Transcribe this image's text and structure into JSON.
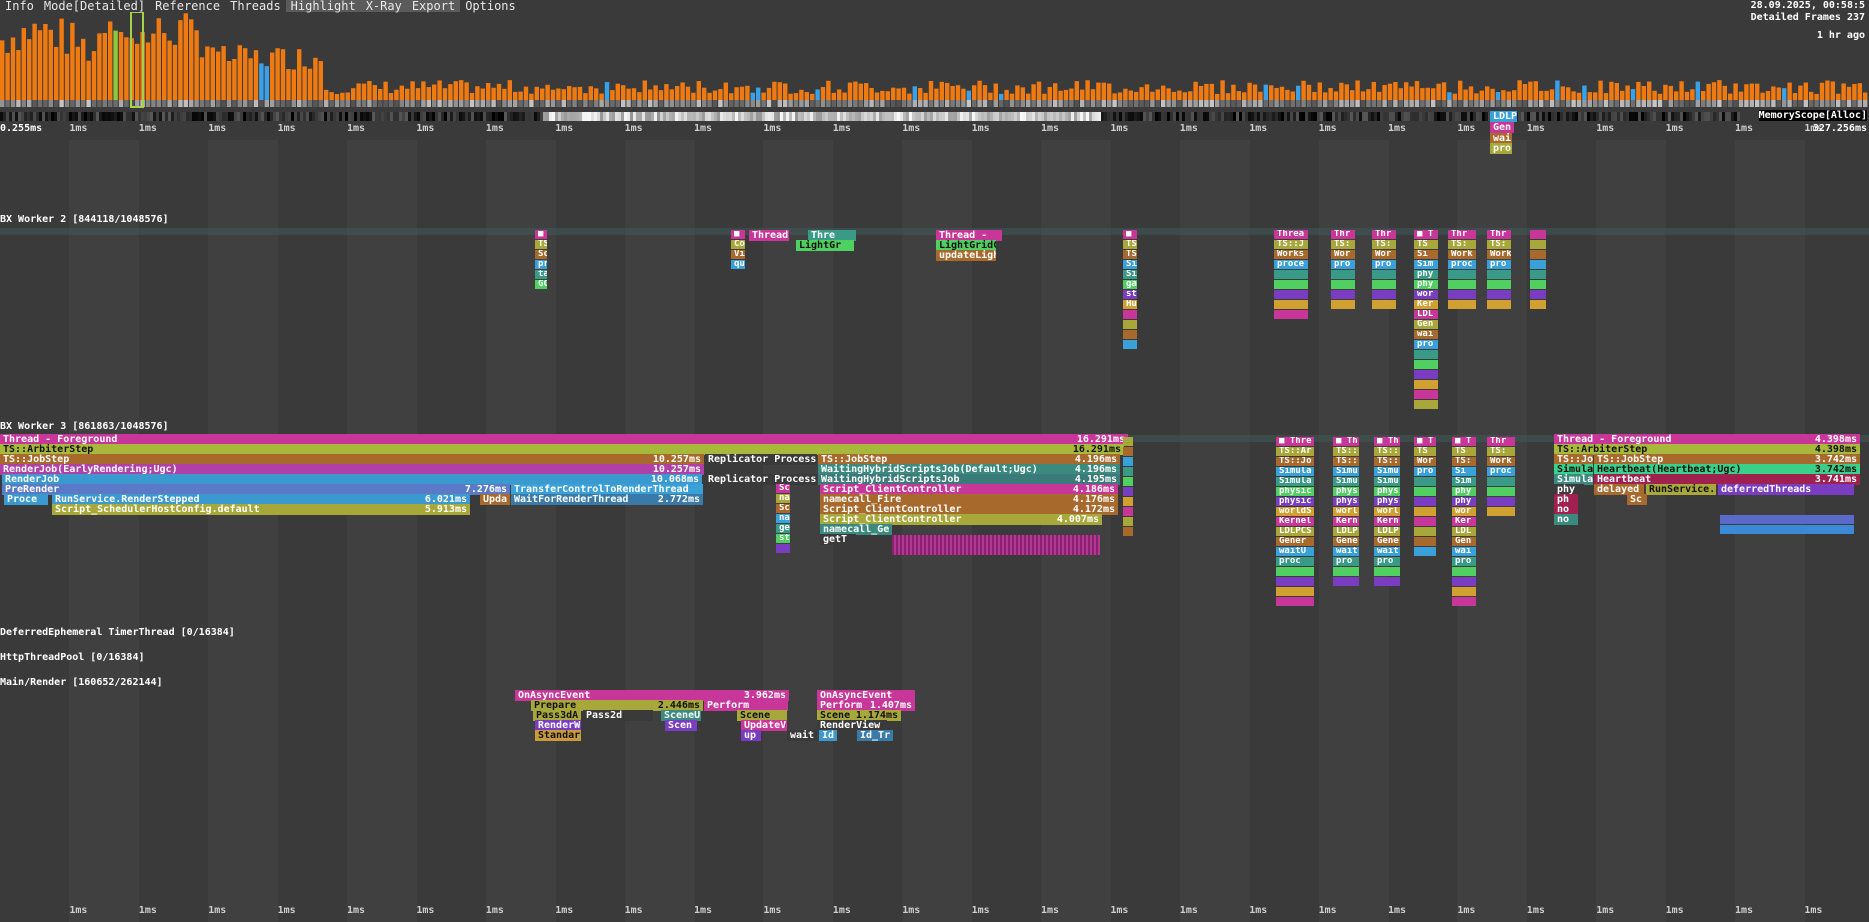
{
  "menu": [
    "Info",
    "Mode[Detailed]",
    "Reference",
    "Threads",
    "Highlight",
    "X-Ray",
    "Export",
    "Options"
  ],
  "status": {
    "date_line": "28.09.2025, 00:58:5",
    "frames_line": "Detailed Frames 237",
    "ago": "1 hr ago"
  },
  "timeline": {
    "start_label": "0.255ms",
    "end_label": "327.256ms",
    "tick_label": "1ms",
    "memory_scope": "MemoryScope[Alloc]",
    "memory_marker": "LDLP",
    "threads": [
      "BX Worker 2 [844118/1048576]",
      "BX Worker 3 [861863/1048576]",
      "DeferredEphemeral TimerThread [0/16384]",
      "HttpThreadPool [0/16384]",
      "Main/Render [160652/262144]"
    ]
  },
  "colors": {
    "bar": "#f07a12",
    "selected_bar": "#8cc83c",
    "highlight_bar": "#3aa0e8",
    "magenta": "#c8369a",
    "olive": "#a8a83a",
    "blue": "#3aa0d8",
    "teal": "#3a9a88",
    "green": "#50d060",
    "brown": "#a86a2c",
    "purple": "#7a3cc0"
  },
  "worker3_blocks": {
    "foreground": {
      "label": "Thread - Foreground",
      "dur": "16.291ms"
    },
    "arbiter": {
      "label": "TS::ArbiterStep",
      "dur": "16.291ms"
    },
    "jobstep": {
      "label": "TS::JobStep",
      "dur": "10.257ms"
    },
    "renderjob_early": {
      "label": "RenderJob(EarlyRendering;Ugc)",
      "dur": "10.257ms"
    },
    "renderjob": {
      "label": "RenderJob",
      "dur": "10.068ms"
    },
    "prerender": {
      "label": "PreRender",
      "dur": "7.276ms"
    },
    "transfer": {
      "label": "TransferControlToRenderThread"
    },
    "proc": {
      "label": "Proce"
    },
    "renderstepped": {
      "label": "RunService.RenderStepped",
      "dur": "6.021ms"
    },
    "upda": {
      "label": "Upda"
    },
    "waitfor": {
      "label": "WaitForRenderThread",
      "dur": "2.772ms"
    },
    "script_sched": {
      "label": "Script_SchedulerHostConfig.default",
      "dur": "5.913ms"
    },
    "replicator1": {
      "label": "Replicator Process"
    },
    "replicator2": {
      "label": "Replicator Process"
    },
    "jobstep2": {
      "label": "TS::JobStep",
      "dur": "4.196ms"
    },
    "waiting": {
      "label": "WaitingHybridScriptsJob(Default;Ugc)",
      "dur": "4.196ms"
    },
    "waiting2": {
      "label": "WaitingHybridScriptsJob",
      "dur": "4.195ms"
    },
    "script_cc": {
      "label": "Script_ClientController",
      "dur": "4.186ms"
    },
    "namecall_fire": {
      "label": "namecall_Fire",
      "dur": "4.176ms"
    },
    "script_cc2": {
      "label": "Script_ClientController",
      "dur": "4.172ms"
    },
    "script_cc3": {
      "label": "Script_ClientController",
      "dur": "4.007ms"
    },
    "namecall_ge": {
      "label": "namecall_Ge"
    },
    "gett": {
      "label": "getT"
    },
    "fg2": {
      "label": "Thread - Foreground",
      "dur": "4.398ms"
    },
    "arbiter2": {
      "label": "TS::ArbiterStep",
      "dur": "4.398ms"
    },
    "ts_jo": {
      "label": "TS::Jo"
    },
    "jobstep3": {
      "label": "TS::JobStep",
      "dur": "3.742ms"
    },
    "simula": {
      "label": "Simula"
    },
    "heartbeat_ugc": {
      "label": "Heartbeat(Heartbeat;Ugc)",
      "dur": "3.742ms"
    },
    "simula2": {
      "label": "Simula"
    },
    "heartbeat": {
      "label": "Heartbeat",
      "dur": "3.741ms"
    },
    "phy": {
      "label": "phy"
    },
    "delayed": {
      "label": "delayed"
    },
    "runservice": {
      "label": "RunService."
    },
    "deferred": {
      "label": "deferredThreads"
    },
    "ph": {
      "label": "ph"
    },
    "sc": {
      "label": "Sc"
    },
    "no1": {
      "label": "no"
    },
    "no2": {
      "label": "no"
    }
  },
  "worker2_blocks": {
    "thread1": "Thread",
    "thread2": "Thre",
    "thread3": "Thread -",
    "lightgr": "LightGr",
    "lightgridc": "LightGridC",
    "updatelight": "updateLigh",
    "thra": "Threa",
    "tsj": "TS::J",
    "works": "Works",
    "proce": "proce"
  },
  "render_blocks": {
    "onasync1": {
      "label": "OnAsyncEvent",
      "dur": "3.962ms"
    },
    "prepare": {
      "label": "Prepare",
      "dur": "2.446ms"
    },
    "perform": {
      "label": "Perform"
    },
    "pass3dadd": {
      "label": "Pass3dA"
    },
    "pass2d": {
      "label": "Pass2d"
    },
    "sceneu": {
      "label": "SceneU"
    },
    "scene": {
      "label": "Scene"
    },
    "renderw": {
      "label": "RenderW"
    },
    "scen": {
      "label": "Scen"
    },
    "updatev": {
      "label": "UpdateV"
    },
    "standar": {
      "label": "Standar"
    },
    "up": {
      "label": "up"
    },
    "wait": {
      "label": "wait"
    },
    "onasync2": {
      "label": "OnAsyncEvent"
    },
    "perform2": {
      "label": "Perform",
      "dur": "1.407ms"
    },
    "scene2": {
      "label": "Scene",
      "dur": "1.174ms"
    },
    "renderview": {
      "label": "RenderView"
    },
    "id": {
      "label": "Id"
    },
    "idtr": {
      "label": "Id_Tr"
    }
  }
}
